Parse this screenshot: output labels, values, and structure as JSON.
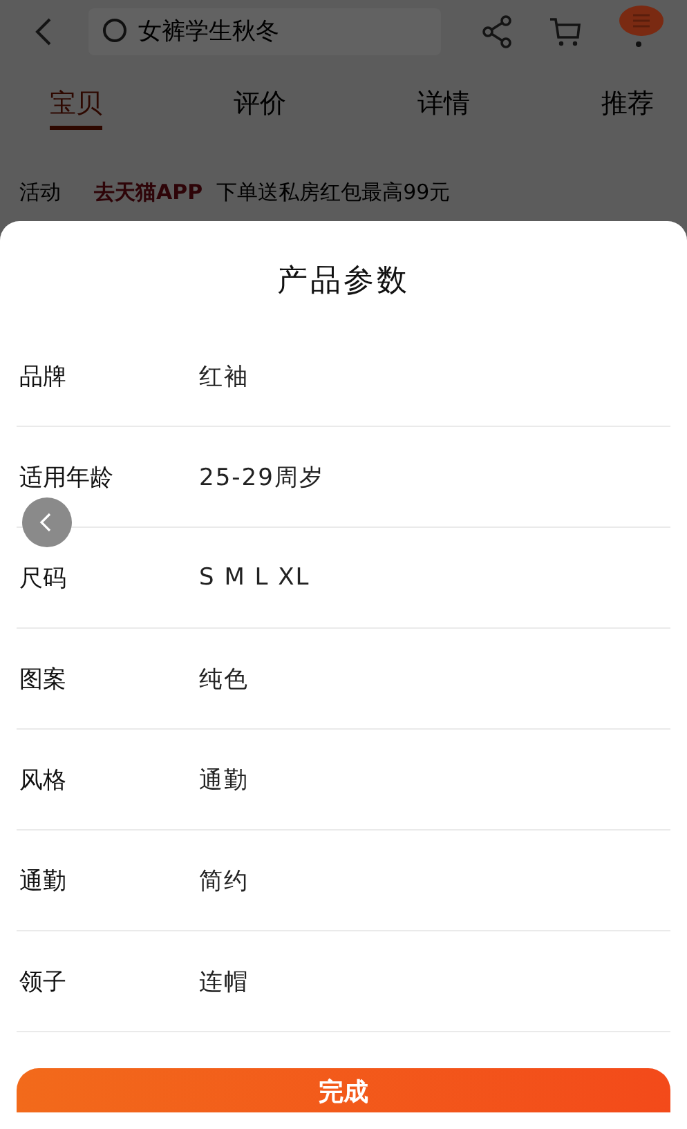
{
  "header": {
    "search": {
      "placeholder": "女裤学生秋冬"
    }
  },
  "tabs": [
    {
      "label": "宝贝",
      "selected": true
    },
    {
      "label": "评价",
      "selected": false
    },
    {
      "label": "详情",
      "selected": false
    },
    {
      "label": "推荐",
      "selected": false
    }
  ],
  "promo": {
    "label": "活动",
    "badge": "去天猫APP",
    "text": "下单送私房红包最高99元"
  },
  "sheet": {
    "title": "产品参数",
    "params": [
      {
        "name": "品牌",
        "value": "红袖"
      },
      {
        "name": "适用年龄",
        "value": "25-29周岁"
      },
      {
        "name": "尺码",
        "value": "S M L XL"
      },
      {
        "name": "图案",
        "value": "纯色"
      },
      {
        "name": "风格",
        "value": "通勤"
      },
      {
        "name": "通勤",
        "value": "简约"
      },
      {
        "name": "领子",
        "value": "连帽"
      }
    ],
    "button": "完成"
  }
}
